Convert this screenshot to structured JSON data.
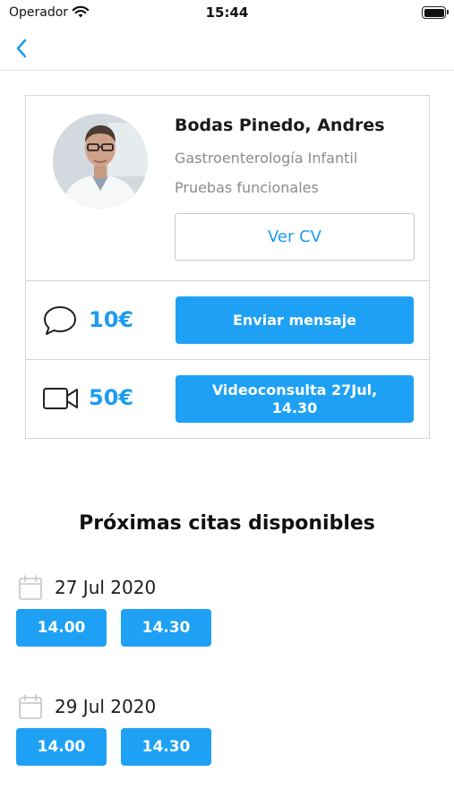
{
  "status_bar": {
    "carrier": "Operador",
    "time": "15:44"
  },
  "nav": {
    "back_icon": "chevron-left-icon"
  },
  "doctor": {
    "name": "Bodas Pinedo, Andres",
    "specialty": "Gastroenterología Infantil",
    "subspecialty": "Pruebas funcionales",
    "cv_label": "Ver CV"
  },
  "message": {
    "icon": "chat-bubble-icon",
    "price": "10€",
    "button_label": "Enviar mensaje"
  },
  "video": {
    "icon": "video-camera-icon",
    "price": "50€",
    "button_label": "Videoconsulta 27Jul, 14.30"
  },
  "appointments": {
    "title": "Próximas citas disponibles",
    "days": [
      {
        "date": "27 Jul 2020",
        "slots": [
          "14.00",
          "14.30"
        ]
      },
      {
        "date": "29 Jul 2020",
        "slots": [
          "14.00",
          "14.30"
        ]
      }
    ]
  },
  "colors": {
    "accent": "#1ea1f4",
    "price_text": "#1e9cf0",
    "secondary_text": "#8b8b8b",
    "border": "#d6d6d6"
  }
}
